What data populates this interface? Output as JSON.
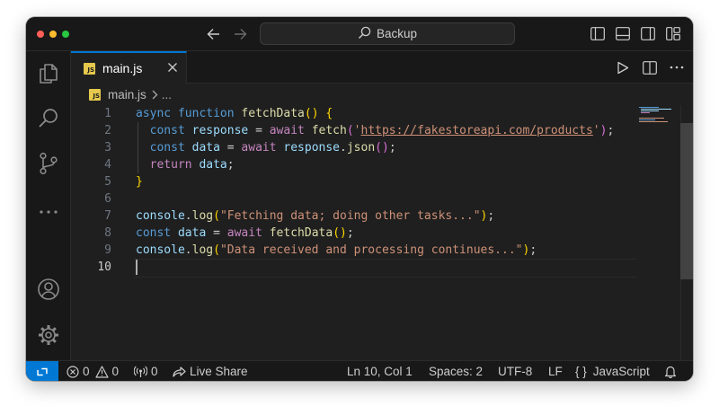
{
  "window": {
    "search_label": "Backup"
  },
  "tab": {
    "file_name": "main.js",
    "badge": "JS"
  },
  "breadcrumb": {
    "file": "main.js",
    "more": "..."
  },
  "editor": {
    "line_numbers": [
      "1",
      "2",
      "3",
      "4",
      "5",
      "6",
      "7",
      "8",
      "9",
      "10"
    ],
    "active_line": "10"
  },
  "code": {
    "l1": {
      "async": "async",
      "function": "function",
      "name": "fetchData",
      "rest": "() {"
    },
    "l2": {
      "const": "const",
      "var": "response",
      "eq": " = ",
      "await": "await",
      "fn": "fetch",
      "open": "(",
      "q1": "'",
      "url": "https://fakestoreapi.com/products",
      "q2": "'",
      "close": ")",
      "semi": ";"
    },
    "l3": {
      "const": "const",
      "var": "data",
      "eq": " = ",
      "await": "await",
      "obj": "response",
      "dot": ".",
      "fn": "json",
      "parens": "()",
      "semi": ";"
    },
    "l4": {
      "return": "return",
      "var": "data",
      "semi": ";"
    },
    "l5": {
      "brace": "}"
    },
    "l7": {
      "obj": "console",
      "dot": ".",
      "fn": "log",
      "open": "(",
      "str": "\"Fetching data; doing other tasks...\"",
      "close": ")",
      "semi": ";"
    },
    "l8": {
      "const": "const",
      "var": "data",
      "eq": " = ",
      "await": "await",
      "fn": "fetchData",
      "parens": "()",
      "semi": ";"
    },
    "l9": {
      "obj": "console",
      "dot": ".",
      "fn": "log",
      "open": "(",
      "str": "\"Data received and processing continues...\"",
      "close": ")",
      "semi": ";"
    }
  },
  "status": {
    "errors": "0",
    "warnings": "0",
    "ports": "0",
    "live_share": "Live Share",
    "position": "Ln 10, Col 1",
    "spaces": "Spaces: 2",
    "encoding": "UTF-8",
    "eol": "LF",
    "language": "JavaScript",
    "language_icon": "{ }"
  },
  "icons": {
    "activity": [
      "files-icon",
      "search-icon",
      "source-control-icon",
      "more-icon",
      "account-icon",
      "settings-gear-icon"
    ],
    "layout": [
      "toggle-primary-sidebar-icon",
      "toggle-panel-icon",
      "toggle-secondary-sidebar-icon",
      "customize-layout-icon"
    ]
  },
  "colors": {
    "accent": "#0078d4",
    "keyword": "#569cd6",
    "control": "#c586c0",
    "function": "#dcdcaa",
    "variable": "#9cdcfe",
    "string": "#ce9178"
  }
}
